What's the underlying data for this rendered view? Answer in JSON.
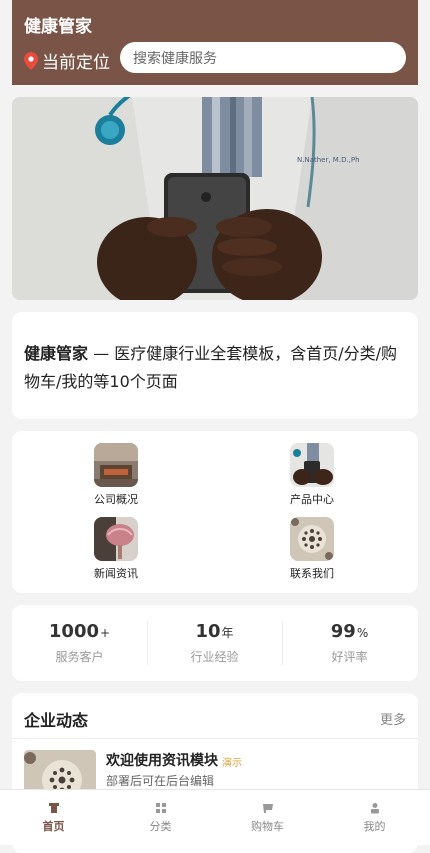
{
  "header": {
    "title": "健康管家",
    "location_label": "当前定位",
    "search_placeholder": "搜索健康服务",
    "accent_color": "#7a5446"
  },
  "intro": {
    "brand": "健康管家",
    "text": " — 医疗健康行业全套模板，含首页/分类/购物车/我的等10个页面"
  },
  "menu": {
    "items": [
      {
        "label": "公司概况",
        "icon": "company-photo-icon"
      },
      {
        "label": "产品中心",
        "icon": "product-photo-icon"
      },
      {
        "label": "新闻资讯",
        "icon": "news-photo-icon"
      },
      {
        "label": "联系我们",
        "icon": "contact-photo-icon"
      }
    ]
  },
  "stats": [
    {
      "number": "1000",
      "unit": "+",
      "label": "服务客户"
    },
    {
      "number": "10",
      "unit": "年",
      "label": "行业经验"
    },
    {
      "number": "99",
      "unit": "%",
      "label": "好评率"
    }
  ],
  "news": {
    "title": "企业动态",
    "more": "更多",
    "item_title": "欢迎使用资讯模块",
    "item_tag": "演示",
    "item_desc": "部署后可在后台编辑"
  },
  "tabbar": {
    "items": [
      {
        "label": "首页",
        "icon": "home-icon"
      },
      {
        "label": "分类",
        "icon": "grid-icon"
      },
      {
        "label": "购物车",
        "icon": "cart-icon"
      },
      {
        "label": "我的",
        "icon": "user-icon"
      }
    ],
    "active": "首页"
  }
}
